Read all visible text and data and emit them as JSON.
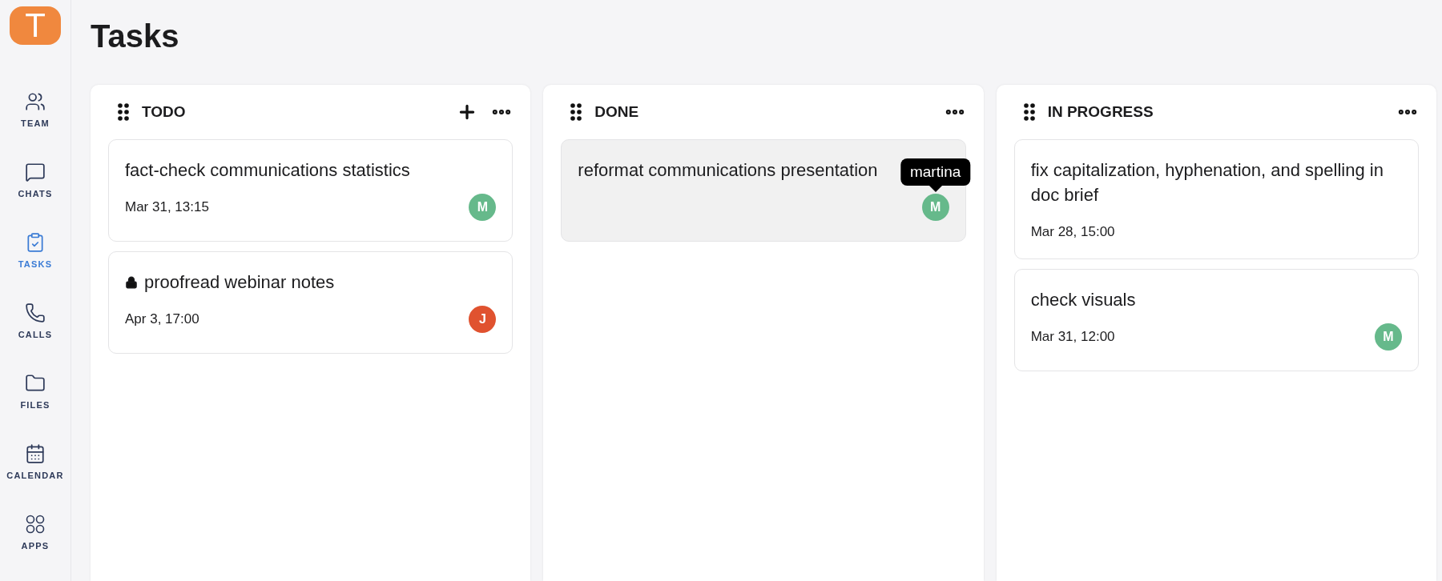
{
  "logo": {
    "letter": "T"
  },
  "sidebar": {
    "items": [
      {
        "label": "TEAM",
        "kind": "team",
        "selected": false
      },
      {
        "label": "CHATS",
        "kind": "chat",
        "selected": false
      },
      {
        "label": "TASKS",
        "kind": "tasks",
        "selected": true
      },
      {
        "label": "CALLS",
        "kind": "phone",
        "selected": false
      },
      {
        "label": "FILES",
        "kind": "folder",
        "selected": false
      },
      {
        "label": "CALENDAR",
        "kind": "calendar",
        "selected": false
      },
      {
        "label": "APPS",
        "kind": "apps",
        "selected": false
      }
    ]
  },
  "page": {
    "title": "Tasks"
  },
  "columns": [
    {
      "title": "TODO",
      "add_button": true,
      "cards": [
        {
          "title": "fact-check communications statistics",
          "locked": false,
          "hovered": false,
          "date": "Mar 31, 13:15",
          "assignee": {
            "initial": "M",
            "color": "#66b98b"
          }
        },
        {
          "title": "proofread webinar notes",
          "locked": true,
          "hovered": false,
          "date": "Apr 3, 17:00",
          "assignee": {
            "initial": "J",
            "color": "#e0522f"
          }
        }
      ]
    },
    {
      "title": "DONE",
      "add_button": false,
      "cards": [
        {
          "title": "reformat communications presentation",
          "locked": false,
          "hovered": true,
          "assignee": {
            "initial": "M",
            "color": "#66b98b",
            "tooltip": "martina"
          }
        }
      ]
    },
    {
      "title": "IN PROGRESS",
      "add_button": false,
      "cards": [
        {
          "title": "fix capitalization, hyphenation, and spelling in doc brief",
          "locked": false,
          "hovered": false,
          "date": "Mar 28, 15:00"
        },
        {
          "title": "check visuals",
          "locked": false,
          "hovered": false,
          "date": "Mar 31, 12:00",
          "assignee": {
            "initial": "M",
            "color": "#66b98b"
          }
        }
      ]
    }
  ]
}
